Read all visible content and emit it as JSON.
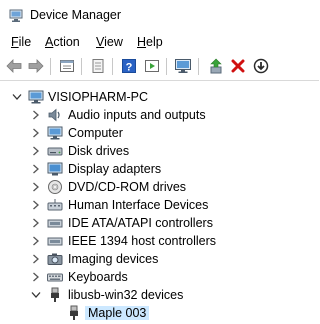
{
  "window": {
    "title": "Device Manager"
  },
  "menu": {
    "items": [
      {
        "underline": "F",
        "rest": "ile"
      },
      {
        "underline": "A",
        "rest": "ction"
      },
      {
        "underline": "V",
        "rest": "iew"
      },
      {
        "underline": "H",
        "rest": "elp"
      }
    ]
  },
  "toolbar": {
    "icons": [
      "back-arrow-icon",
      "forward-arrow-icon",
      "properties-icon",
      "show-hidden-icon",
      "help-icon",
      "action-icon",
      "monitor-icon",
      "update-driver-icon",
      "uninstall-icon",
      "disable-device-icon"
    ],
    "colors": {
      "green": "#3aa33a",
      "red": "#d01010",
      "blue": "#1e5fbf"
    }
  },
  "tree": {
    "root": "VISIOPHARM-PC",
    "categories": [
      "Audio inputs and outputs",
      "Computer",
      "Disk drives",
      "Display adapters",
      "DVD/CD-ROM drives",
      "Human Interface Devices",
      "IDE ATA/ATAPI controllers",
      "IEEE 1394 host controllers",
      "Imaging devices",
      "Keyboards",
      "libusb-win32 devices"
    ],
    "child": "Maple 003",
    "selection_color": "#cce8ff"
  }
}
